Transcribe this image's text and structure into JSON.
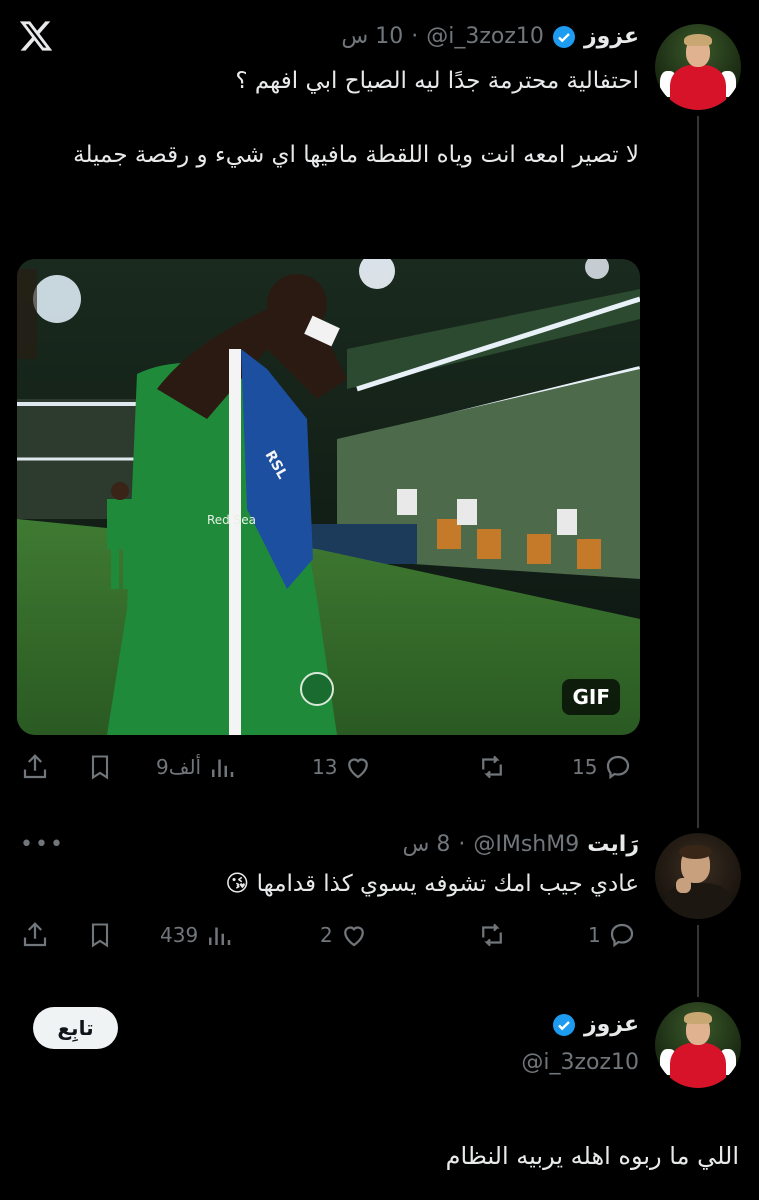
{
  "header": {
    "logo_icon": "x-logo-icon"
  },
  "tweet1": {
    "display_name": "عزوز",
    "handle": "@i_3zoz10",
    "separator": "·",
    "time": "10 س",
    "text_line1": "احتفالية محترمة جدًا ليه الصياح ابي افهم ؟",
    "text_line2": "لا تصير امعه انت وياه اللقطة مافيها اي شيء و رقصة جميلة",
    "media_badge": "GIF",
    "replies": "15",
    "reposts": "",
    "likes": "13",
    "views": "9ألف"
  },
  "tweet2": {
    "display_name": "رَايت",
    "handle": "@IMshM9",
    "separator": "·",
    "time": "8 س",
    "text": "عادي جيب امك تشوفه يسوي كذا قدامها 😘",
    "replies": "1",
    "likes": "2",
    "views": "439",
    "more": "•••"
  },
  "tweet3": {
    "display_name": "عزوز",
    "handle": "@i_3zoz10",
    "follow_label": "تابِع",
    "text": "اللي ما ربوه اهله يربيه النظام"
  },
  "colors": {
    "background": "#000000",
    "verified": "#1d9bf0",
    "muted": "#71767b",
    "text": "#e7e9ea"
  }
}
